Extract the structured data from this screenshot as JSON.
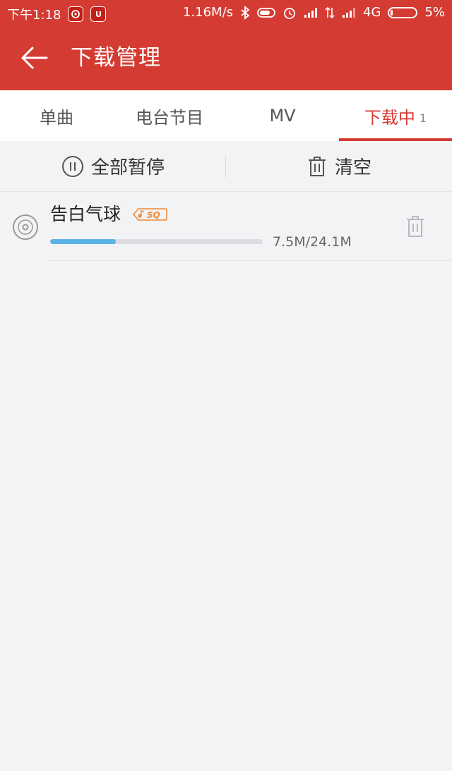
{
  "status_bar": {
    "time": "下午1:18",
    "app_badge_1": "网易",
    "app_badge_2": "UE",
    "network_speed": "1.16M/s",
    "network_type": "4G",
    "battery": "5%",
    "battery_level": 0.05
  },
  "header": {
    "title": "下载管理"
  },
  "tabs": [
    {
      "label": "单曲",
      "count": ""
    },
    {
      "label": "电台节目",
      "count": ""
    },
    {
      "label": "MV",
      "count": ""
    },
    {
      "label": "下载中",
      "count": "1"
    }
  ],
  "actions": {
    "pause_all": "全部暂停",
    "clear": "清空"
  },
  "downloads": [
    {
      "title": "告白气球",
      "quality_badge": "SQ",
      "progress": 0.31,
      "size_text": "7.5M/24.1M"
    }
  ],
  "colors": {
    "brand_red": "#d43c33",
    "progress_blue": "#5cb3e6",
    "sq_orange": "#f08a36",
    "background": "#f2f3f5"
  },
  "icons": {
    "back": "arrow-left-icon",
    "pause": "pause-circle-icon",
    "clear": "trash-icon",
    "song": "disc-icon",
    "delete": "trash-icon"
  }
}
